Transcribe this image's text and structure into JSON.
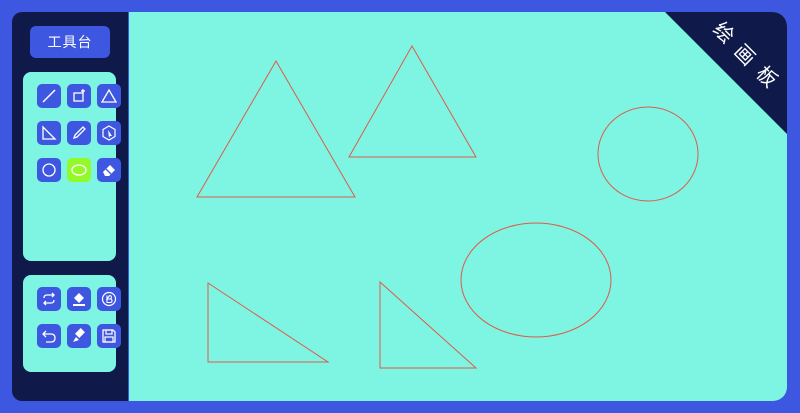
{
  "sidebar": {
    "title": "工具台",
    "tools": [
      {
        "name": "line-tool",
        "icon": "line-icon"
      },
      {
        "name": "rectangle-tool",
        "icon": "rectangle-icon"
      },
      {
        "name": "triangle-tool",
        "icon": "triangle-icon"
      },
      {
        "name": "right-triangle-tool",
        "icon": "right-triangle-icon"
      },
      {
        "name": "pencil-tool",
        "icon": "pencil-icon"
      },
      {
        "name": "select-tool",
        "icon": "cursor-icon"
      },
      {
        "name": "circle-tool",
        "icon": "circle-icon"
      },
      {
        "name": "ellipse-tool",
        "icon": "ellipse-icon",
        "active": true
      },
      {
        "name": "eraser-tool",
        "icon": "eraser-icon"
      }
    ],
    "actions": [
      {
        "name": "redo-button",
        "icon": "repeat-icon"
      },
      {
        "name": "fill-button",
        "icon": "paint-bucket-icon"
      },
      {
        "name": "border-button",
        "icon": "letter-b-icon"
      },
      {
        "name": "undo-button",
        "icon": "undo-icon"
      },
      {
        "name": "clear-button",
        "icon": "brush-icon"
      },
      {
        "name": "save-button",
        "icon": "save-icon"
      }
    ]
  },
  "canvas": {
    "corner_label": [
      "绘",
      "画",
      "板"
    ],
    "stroke_color": "#e05a4a",
    "background": "#7ef5e2"
  },
  "colors": {
    "frame": "#3e57e0",
    "sidebar": "#0f1a4a",
    "active_tool": "#93f92b"
  }
}
